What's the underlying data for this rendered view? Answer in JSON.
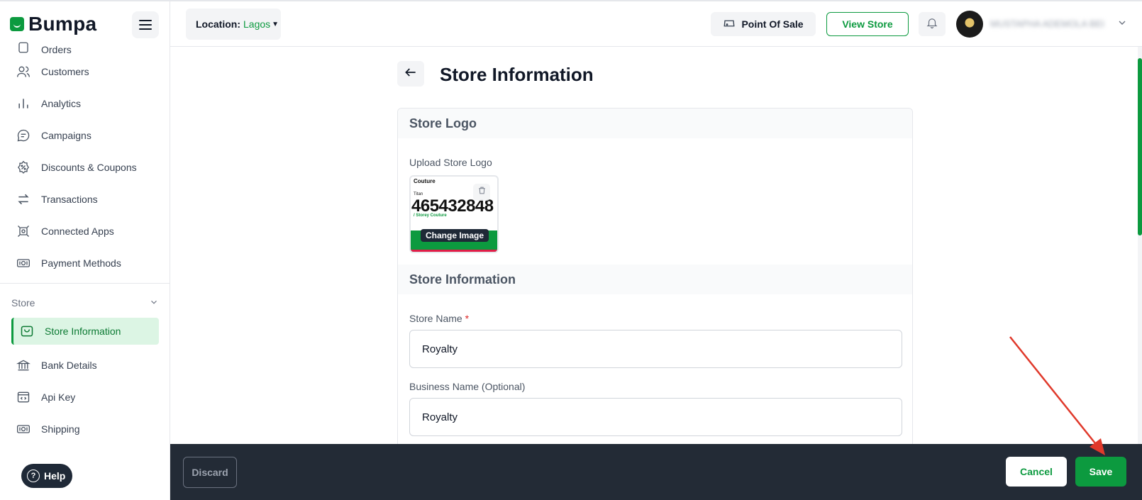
{
  "brand": {
    "name": "Bumpa"
  },
  "header": {
    "location_label": "Location:",
    "location_value": "Lagos",
    "pos_label": "Point Of Sale",
    "view_store_label": "View Store",
    "user_name": "MUSTAPHA ADEMOLA BELLO"
  },
  "sidebar": {
    "items": [
      {
        "label": "Orders",
        "icon": "orders-icon"
      },
      {
        "label": "Customers",
        "icon": "users-icon"
      },
      {
        "label": "Analytics",
        "icon": "bar-chart-icon"
      },
      {
        "label": "Campaigns",
        "icon": "chat-icon"
      },
      {
        "label": "Discounts & Coupons",
        "icon": "discount-icon"
      },
      {
        "label": "Transactions",
        "icon": "transfer-icon"
      },
      {
        "label": "Connected Apps",
        "icon": "apps-icon"
      },
      {
        "label": "Payment Methods",
        "icon": "cash-icon"
      }
    ],
    "section_title": "Store",
    "store_items": [
      {
        "label": "Store Information",
        "icon": "bag-icon",
        "active": true
      },
      {
        "label": "Bank Details",
        "icon": "bank-icon"
      },
      {
        "label": "Api Key",
        "icon": "code-icon"
      },
      {
        "label": "Shipping",
        "icon": "cash-icon"
      }
    ],
    "help_label": "Help"
  },
  "main": {
    "page_title": "Store Information",
    "logo_section_title": "Store Logo",
    "upload_label": "Upload Store Logo",
    "change_image_label": "Change Image",
    "logo_preview": {
      "brand": "Couture",
      "titan": "Titan",
      "number": "465432848",
      "store_line": "/ Storey Couture"
    },
    "info_section_title": "Store Information",
    "store_name_label": "Store Name",
    "store_name_required": "*",
    "store_name_value": "Royalty",
    "business_name_label": "Business Name (Optional)",
    "business_name_value": "Royalty"
  },
  "actions": {
    "discard_label": "Discard",
    "cancel_label": "Cancel",
    "save_label": "Save"
  },
  "colors": {
    "brand_green": "#0c9a3f",
    "active_bg": "#dcf5e4",
    "action_bar": "#232b36",
    "annotation_red": "#e0392b"
  }
}
